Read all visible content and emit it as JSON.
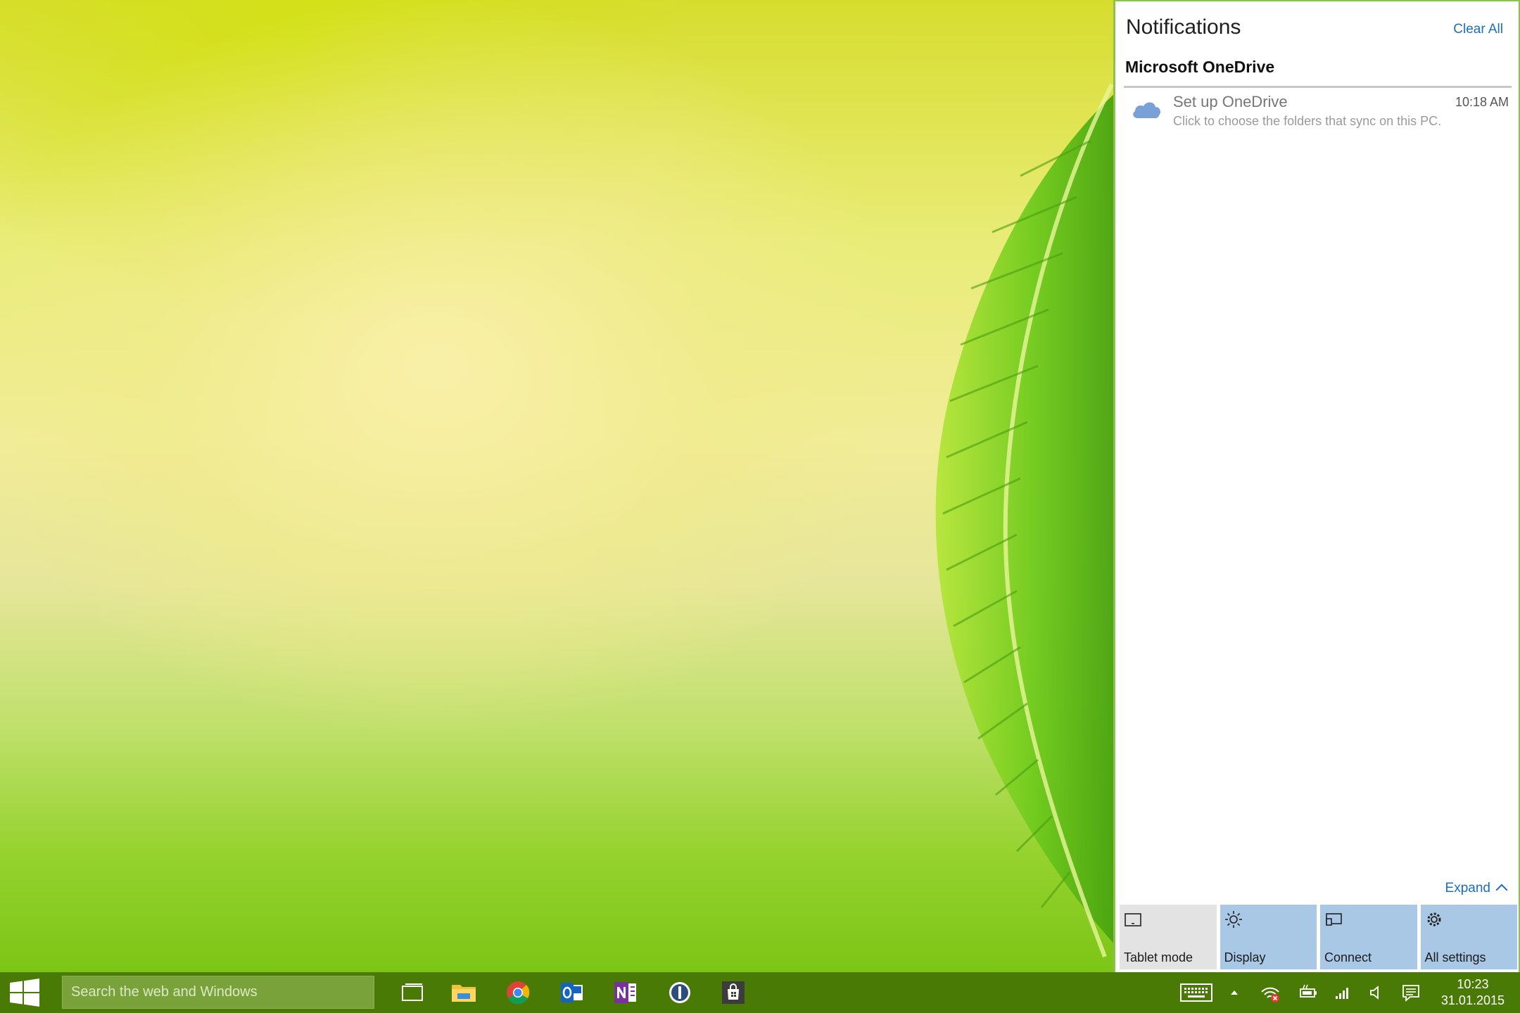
{
  "action_center": {
    "title": "Notifications",
    "clear_all": "Clear All",
    "group_name": "Microsoft OneDrive",
    "notification": {
      "icon": "onedrive-cloud-icon",
      "title": "Set up OneDrive",
      "time": "10:18 AM",
      "body": "Click to choose the folders that sync on this PC."
    },
    "expand": "Expand",
    "quick_actions": [
      {
        "label": "Tablet mode",
        "icon": "tablet-mode-icon",
        "active": false
      },
      {
        "label": "Display",
        "icon": "brightness-icon",
        "active": true
      },
      {
        "label": "Connect",
        "icon": "connect-icon",
        "active": true
      },
      {
        "label": "All settings",
        "icon": "gear-icon",
        "active": true
      }
    ]
  },
  "taskbar": {
    "search_placeholder": "Search the web and Windows",
    "apps": [
      "task-view-icon",
      "file-explorer-icon",
      "chrome-icon",
      "outlook-icon",
      "onenote-icon",
      "1password-icon",
      "store-icon"
    ],
    "tray": [
      "touch-keyboard-icon",
      "show-hidden-icons-chevron",
      "network-icon",
      "battery-icon",
      "signal-icon",
      "volume-icon",
      "action-center-icon"
    ],
    "time": "10:23",
    "date": "31.01.2015"
  },
  "colors": {
    "taskbar": "#4a7a06",
    "accent_link": "#1a6fbe",
    "quick_action_on": "#a8c8e6",
    "quick_action_off": "#e3e3e3"
  }
}
